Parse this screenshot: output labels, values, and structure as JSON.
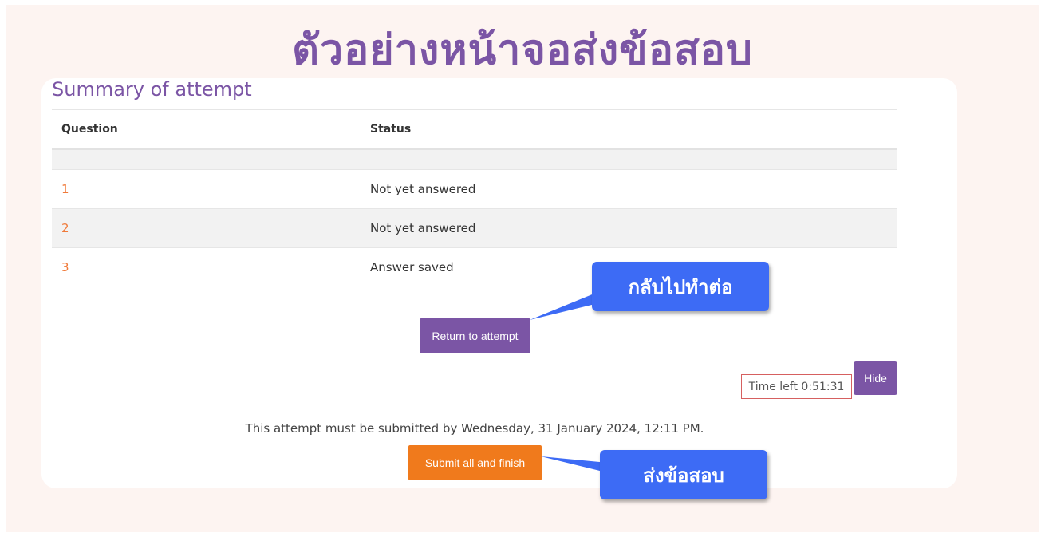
{
  "slide": {
    "title": "ตัวอย่างหน้าจอส่งข้อสอบ"
  },
  "page": {
    "heading": "Summary of attempt"
  },
  "table": {
    "headers": [
      "Question",
      "Status"
    ],
    "rows": [
      {
        "question": "1",
        "status": "Not yet answered"
      },
      {
        "question": "2",
        "status": "Not yet answered"
      },
      {
        "question": "3",
        "status": "Answer saved"
      }
    ]
  },
  "actions": {
    "return_label": "Return to attempt",
    "hide_label": "Hide",
    "submit_label": "Submit all and finish"
  },
  "timer": {
    "text": "Time left 0:51:31"
  },
  "deadline": {
    "text": "This attempt must be submitted by Wednesday, 31 January 2024, 12:11 PM."
  },
  "callouts": {
    "return": "กลับไปทำต่อ",
    "submit": "ส่งข้อสอบ"
  },
  "colors": {
    "brand_purple": "#7b55a5",
    "link_orange": "#f07a3a",
    "submit_orange": "#f07a1c",
    "callout_blue": "#3d6bf5"
  }
}
